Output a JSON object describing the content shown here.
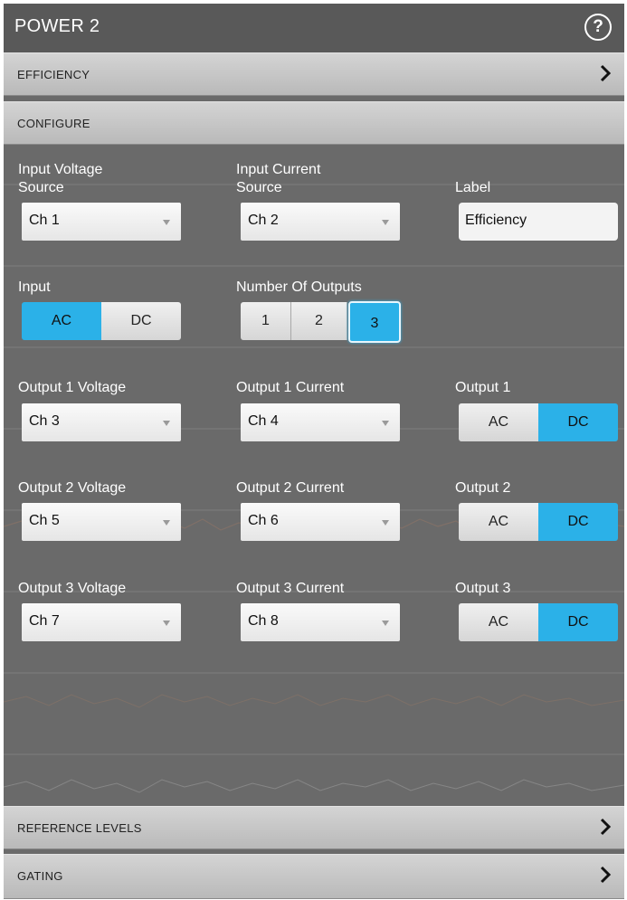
{
  "header": {
    "title": "POWER 2",
    "help_icon_glyph": "?"
  },
  "sections": {
    "efficiency": "EFFICIENCY",
    "configure": "CONFIGURE",
    "reference_levels": "REFERENCE LEVELS",
    "gating": "GATING"
  },
  "configure": {
    "input_voltage_label_1": "Input Voltage",
    "input_voltage_label_2": "Source",
    "input_voltage_value": "Ch 1",
    "input_current_label_1": "Input Current",
    "input_current_label_2": "Source",
    "input_current_value": "Ch 2",
    "label_label": "Label",
    "label_value": "Efficiency",
    "input_label": "Input",
    "input_options": [
      "AC",
      "DC"
    ],
    "input_selected": "AC",
    "num_outputs_label": "Number Of Outputs",
    "num_outputs_options": [
      "1",
      "2",
      "3"
    ],
    "num_outputs_selected": "3",
    "outputs": [
      {
        "voltage_label": "Output 1 Voltage",
        "voltage_value": "Ch 3",
        "current_label": "Output 1 Current",
        "current_value": "Ch 4",
        "coupling_label": "Output 1",
        "options": [
          "AC",
          "DC"
        ],
        "selected": "DC"
      },
      {
        "voltage_label": "Output 2 Voltage",
        "voltage_value": "Ch 5",
        "current_label": "Output 2 Current",
        "current_value": "Ch 6",
        "coupling_label": "Output 2",
        "options": [
          "AC",
          "DC"
        ],
        "selected": "DC"
      },
      {
        "voltage_label": "Output 3 Voltage",
        "voltage_value": "Ch 7",
        "current_label": "Output 3 Current",
        "current_value": "Ch 8",
        "coupling_label": "Output 3",
        "options": [
          "AC",
          "DC"
        ],
        "selected": "DC"
      }
    ]
  },
  "colors": {
    "accent": "#2bb1e8",
    "panel": "#6a6a6a",
    "header": "#595959"
  }
}
